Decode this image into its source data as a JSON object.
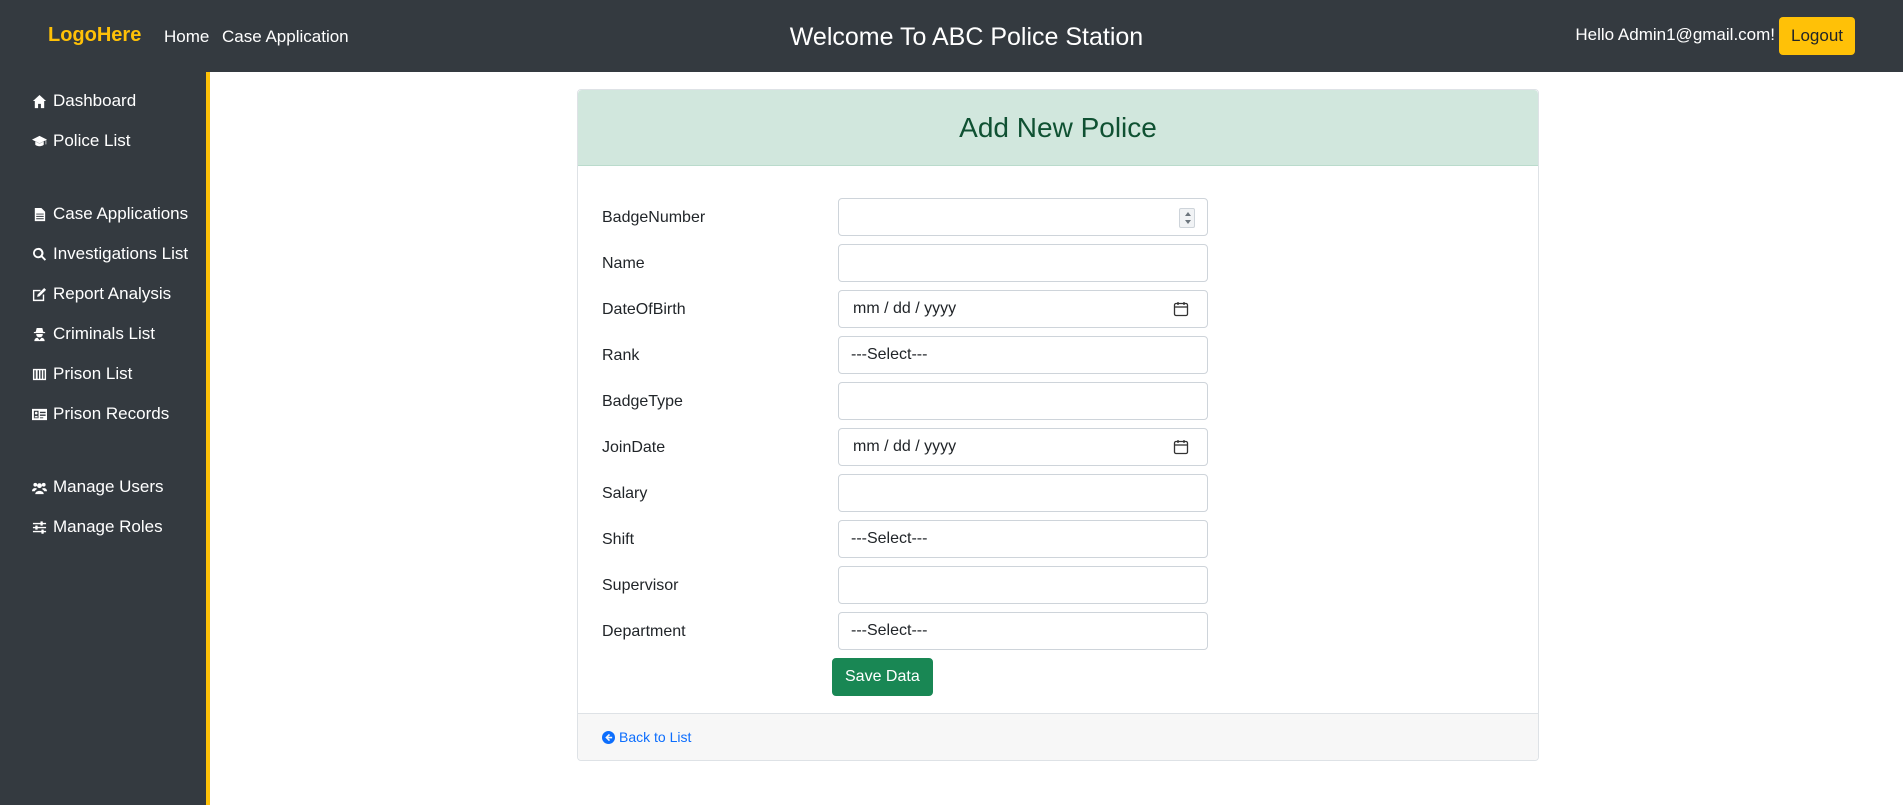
{
  "navbar": {
    "logo": "LogoHere",
    "links": [
      {
        "label": "Home"
      },
      {
        "label": "Case Application"
      }
    ],
    "title": "Welcome To ABC Police Station",
    "greeting": "Hello Admin1@gmail.com!",
    "logout_label": "Logout"
  },
  "sidebar": {
    "items": [
      {
        "label": "Dashboard",
        "icon": "home-icon"
      },
      {
        "label": "Police List",
        "icon": "graduation-cap-icon"
      },
      {
        "label": "Case Applications",
        "icon": "file-icon"
      },
      {
        "label": "Investigations List",
        "icon": "search-icon"
      },
      {
        "label": "Report Analysis",
        "icon": "edit-icon"
      },
      {
        "label": "Criminals List",
        "icon": "user-secret-icon"
      },
      {
        "label": "Prison List",
        "icon": "prison-icon"
      },
      {
        "label": "Prison Records",
        "icon": "id-card-icon"
      },
      {
        "label": "Manage Users",
        "icon": "users-icon"
      },
      {
        "label": "Manage Roles",
        "icon": "sliders-icon"
      }
    ]
  },
  "form": {
    "title": "Add New Police",
    "fields": [
      {
        "label": "BadgeNumber",
        "type": "number",
        "value": ""
      },
      {
        "label": "Name",
        "type": "text",
        "value": ""
      },
      {
        "label": "DateOfBirth",
        "type": "date",
        "value": "mm / dd / yyyy"
      },
      {
        "label": "Rank",
        "type": "select",
        "value": "---Select---"
      },
      {
        "label": "BadgeType",
        "type": "text",
        "value": ""
      },
      {
        "label": "JoinDate",
        "type": "date",
        "value": "mm / dd / yyyy"
      },
      {
        "label": "Salary",
        "type": "text",
        "value": ""
      },
      {
        "label": "Shift",
        "type": "select",
        "value": "---Select---"
      },
      {
        "label": "Supervisor",
        "type": "text",
        "value": ""
      },
      {
        "label": "Department",
        "type": "select",
        "value": "---Select---"
      }
    ],
    "save_label": "Save Data",
    "back_label": "Back to List"
  },
  "colors": {
    "navbar_bg": "#343a40",
    "accent": "#ffc107",
    "header_bg": "#d1e7dd",
    "header_text": "#0f5132",
    "save_btn": "#198754",
    "link": "#0d6efd"
  }
}
